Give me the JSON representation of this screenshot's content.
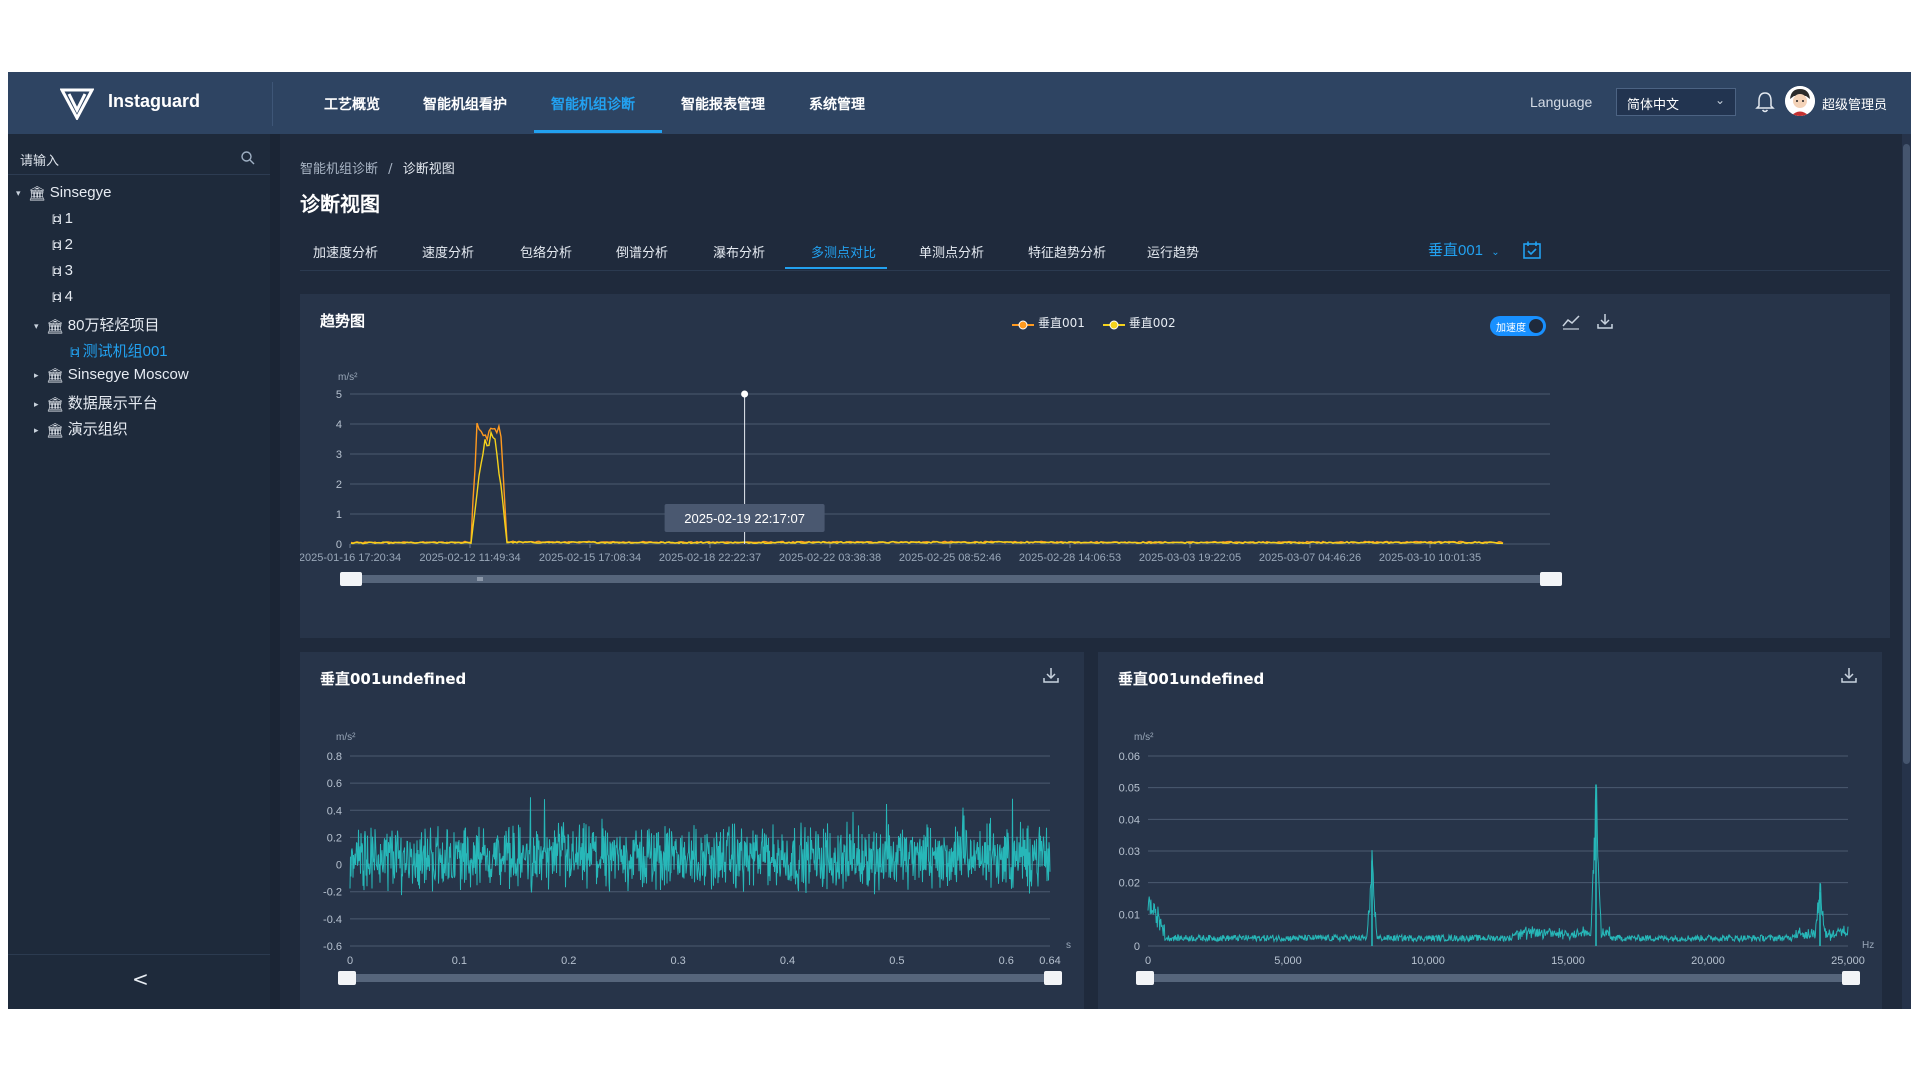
{
  "app": {
    "brand": "Instaguard"
  },
  "nav": {
    "items": [
      {
        "label": "工艺概览",
        "active": false
      },
      {
        "label": "智能机组看护",
        "active": false
      },
      {
        "label": "智能机组诊断",
        "active": true
      },
      {
        "label": "智能报表管理",
        "active": false
      },
      {
        "label": "系统管理",
        "active": false
      }
    ]
  },
  "header": {
    "language_label": "Language",
    "language_value": "简体中文",
    "username": "超级管理员",
    "icons": [
      "bell-icon",
      "avatar"
    ]
  },
  "sidebar": {
    "search_placeholder": "请输入",
    "tree": [
      {
        "label": "Sinsegye",
        "type": "org",
        "expanded": true
      },
      {
        "label": "1",
        "type": "machine"
      },
      {
        "label": "2",
        "type": "machine"
      },
      {
        "label": "3",
        "type": "machine"
      },
      {
        "label": "4",
        "type": "machine"
      },
      {
        "label": "80万轻烃项目",
        "type": "org",
        "expanded": true
      },
      {
        "label": "测试机组001",
        "type": "machine",
        "selected": true
      },
      {
        "label": "Sinsegye Moscow",
        "type": "org",
        "expanded": false
      },
      {
        "label": "数据展示平台",
        "type": "org",
        "expanded": false
      },
      {
        "label": "演示组织",
        "type": "org",
        "expanded": false
      }
    ],
    "collapse_label": "<"
  },
  "breadcrumb": {
    "parent": "智能机组诊断",
    "separator": "/",
    "current": "诊断视图"
  },
  "page_title": "诊断视图",
  "tabs": {
    "items": [
      "加速度分析",
      "速度分析",
      "包络分析",
      "倒谱分析",
      "瀑布分析",
      "多测点对比",
      "单测点分析",
      "特征趋势分析",
      "运行趋势"
    ],
    "active_index": 5,
    "point_select": "垂直001"
  },
  "colors": {
    "accent": "#22a1f0",
    "series1": "#ff9a1f",
    "series2": "#f4d21c",
    "wave": "#27b7b8"
  },
  "trend": {
    "title": "趋势图",
    "legend": [
      "垂直001",
      "垂直002"
    ],
    "toggle_label": "加速度",
    "tooltip": "2025-02-19 22:17:07"
  },
  "wave_card": {
    "title": "垂直001undefined"
  },
  "spectrum_card": {
    "title": "垂直001undefined"
  },
  "chart_data": [
    {
      "type": "line",
      "title": "趋势图",
      "ylabel": "m/s²",
      "ylim": [
        0,
        5
      ],
      "yticks": [
        "0",
        "1",
        "2",
        "3",
        "4",
        "5"
      ],
      "x_tick_labels": [
        "2025-01-16 17:20:34",
        "2025-02-12 11:49:34",
        "2025-02-15 17:08:34",
        "2025-02-18 22:22:37",
        "2025-02-22 03:38:38",
        "2025-02-25 08:52:46",
        "2025-02-28 14:06:53",
        "2025-03-03 19:22:05",
        "2025-03-07 04:46:26",
        "2025-03-10 10:01:35"
      ],
      "series": [
        {
          "name": "垂直001",
          "x_index": [
            0,
            0.9,
            1.0,
            1.05,
            1.12,
            1.18,
            1.25,
            1.3,
            1.4,
            3.0,
            5.0,
            7.0,
            9.0,
            9.6
          ],
          "values": [
            0.02,
            0.03,
            0.05,
            3.8,
            3.5,
            4.0,
            3.6,
            0.05,
            0.04,
            0.03,
            0.04,
            0.03,
            0.04,
            0.03
          ]
        },
        {
          "name": "垂直002",
          "x_index": [
            0,
            1.0,
            1.1,
            1.2,
            1.3,
            3.0,
            5.0,
            7.0,
            9.0,
            9.6
          ],
          "values": [
            0.01,
            0.02,
            3.2,
            3.7,
            0.03,
            0.02,
            0.03,
            0.02,
            0.02,
            0.02
          ]
        }
      ],
      "marker": {
        "x_index": 3.28,
        "value": 5
      }
    },
    {
      "type": "line",
      "title": "垂直001undefined",
      "ylabel": "m/s²",
      "xunit": "s",
      "xlim": [
        0,
        0.64
      ],
      "ylim": [
        -0.6,
        0.8
      ],
      "xticks": [
        "0",
        "0.1",
        "0.2",
        "0.3",
        "0.4",
        "0.5",
        "0.6",
        "0.64"
      ],
      "yticks": [
        "0.8",
        "0.6",
        "0.4",
        "0.2",
        "0",
        "-0.2",
        "-0.4",
        "-0.6"
      ],
      "series": [
        {
          "name": "垂直001",
          "description_range": [
            -0.45,
            0.65
          ]
        }
      ]
    },
    {
      "type": "line",
      "title": "垂直001undefined",
      "ylabel": "m/s²",
      "xunit": "Hz",
      "xlim": [
        0,
        25000
      ],
      "ylim": [
        0,
        0.06
      ],
      "xticks": [
        "0",
        "5,000",
        "10,000",
        "15,000",
        "20,000",
        "25,000"
      ],
      "yticks": [
        "0.06",
        "0.05",
        "0.04",
        "0.03",
        "0.02",
        "0.01",
        "0"
      ],
      "peaks": [
        {
          "x": 8000,
          "value": 0.027
        },
        {
          "x": 16000,
          "value": 0.051
        },
        {
          "x": 24000,
          "value": 0.017
        }
      ]
    }
  ]
}
